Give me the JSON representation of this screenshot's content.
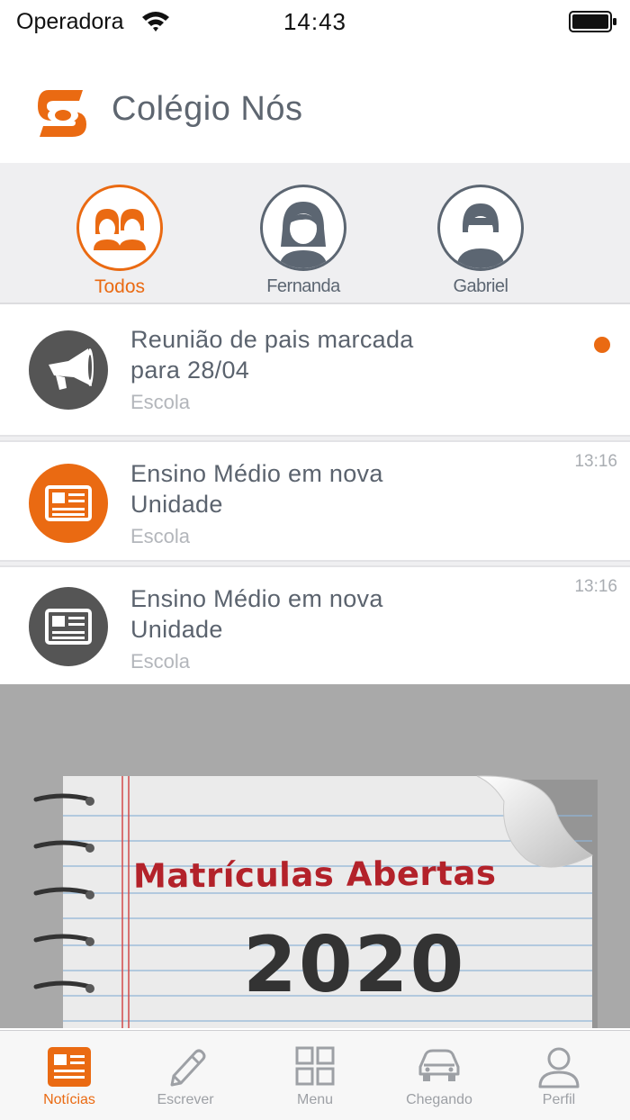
{
  "status_bar": {
    "carrier": "Operadora",
    "time": "14:43"
  },
  "header": {
    "title": "Colégio Nós",
    "brand_color": "#ea6a12"
  },
  "filters": [
    {
      "label": "Todos",
      "active": true
    },
    {
      "label": "Fernanda",
      "active": false
    },
    {
      "label": "Gabriel",
      "active": false
    }
  ],
  "feed": [
    {
      "title_line1": "Reunião de pais marcada",
      "title_line2": "para 28/04",
      "source": "Escola",
      "time": "",
      "icon": "megaphone-icon",
      "unread": true
    },
    {
      "title_line1": "Ensino Médio em nova",
      "title_line2": "Unidade",
      "source": "Escola",
      "time": "13:16",
      "icon": "newspaper-icon",
      "unread": false
    },
    {
      "title_line1": "Ensino Médio em nova",
      "title_line2": "Unidade",
      "source": "Escola",
      "time": "13:16",
      "icon": "newspaper-icon",
      "unread": false
    }
  ],
  "banner": {
    "headline": "Matrículas Abertas",
    "year": "2020"
  },
  "tabs": [
    {
      "label": "Notícias",
      "icon": "news-icon",
      "active": true
    },
    {
      "label": "Escrever",
      "icon": "pencil-icon",
      "active": false
    },
    {
      "label": "Menu",
      "icon": "grid-icon",
      "active": false
    },
    {
      "label": "Chegando",
      "icon": "car-icon",
      "active": false
    },
    {
      "label": "Perfil",
      "icon": "person-icon",
      "active": false
    }
  ],
  "colors": {
    "accent": "#ea6a12",
    "dark_icon": "#555555",
    "text": "#5b636e",
    "muted": "#b3b6bb"
  }
}
